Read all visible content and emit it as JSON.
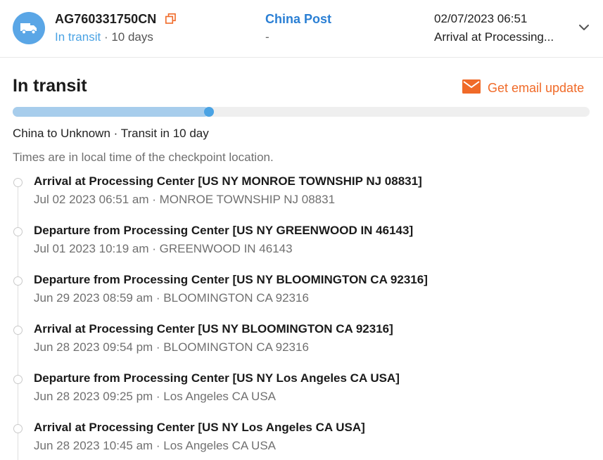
{
  "header": {
    "tracking_number": "AG760331750CN",
    "status": "In transit",
    "separator": "·",
    "days": "10 days",
    "carrier": "China Post",
    "carrier_sub": "-",
    "latest_time": "02/07/2023 06:51",
    "latest_event": "Arrival at Processing...",
    "icons": {
      "shipment": "truck-icon",
      "copy": "copy-icon",
      "expand": "chevron-down-icon"
    }
  },
  "detail": {
    "title": "In transit",
    "email_update_label": "Get email update",
    "email_icon": "envelope-icon",
    "progress_fraction": 0.34,
    "route": "China to Unknown · Transit in 10 day",
    "time_note": "Times are in local time of the checkpoint location."
  },
  "events": [
    {
      "title": "Arrival at Processing Center [US NY MONROE TOWNSHIP NJ 08831]",
      "meta": "Jul 02 2023 06:51 am · MONROE TOWNSHIP NJ 08831"
    },
    {
      "title": "Departure from Processing Center [US NY GREENWOOD IN 46143]",
      "meta": "Jul 01 2023 10:19 am · GREENWOOD IN 46143"
    },
    {
      "title": "Departure from Processing Center [US NY BLOOMINGTON CA 92316]",
      "meta": "Jun 29 2023 08:59 am · BLOOMINGTON CA 92316"
    },
    {
      "title": "Arrival at Processing Center [US NY BLOOMINGTON CA 92316]",
      "meta": "Jun 28 2023 09:54 pm · BLOOMINGTON CA 92316"
    },
    {
      "title": "Departure from Processing Center [US NY Los Angeles CA USA]",
      "meta": "Jun 28 2023 09:25 pm · Los Angeles CA USA"
    },
    {
      "title": "Arrival at Processing Center [US NY Los Angeles CA USA]",
      "meta": "Jun 28 2023 10:45 am · Los Angeles CA USA"
    }
  ],
  "colors": {
    "accent_blue": "#4aa3e4",
    "carrier_blue": "#2a7fd4",
    "email_orange": "#f06a28",
    "progress_fill": "#a7cdec",
    "progress_track": "#efefef"
  }
}
